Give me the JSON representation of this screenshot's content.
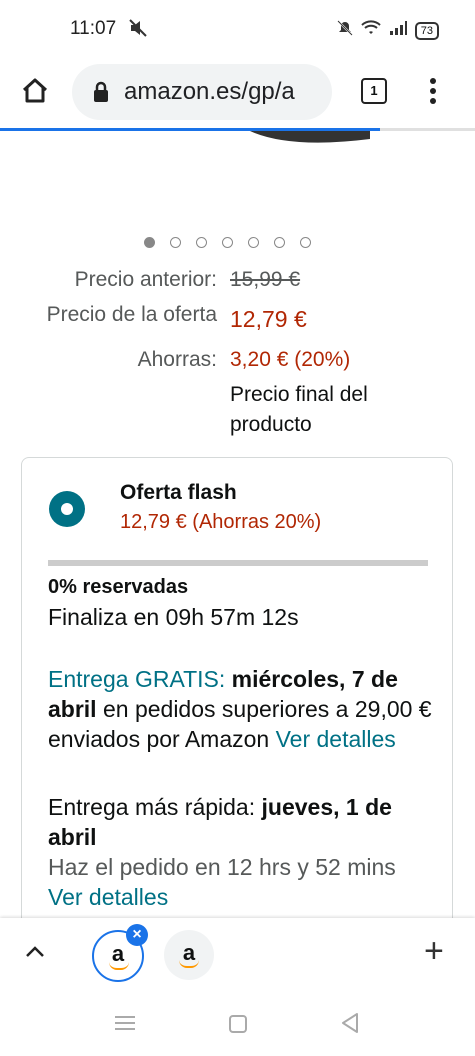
{
  "status_bar": {
    "time": "11:07",
    "battery": "73"
  },
  "browser": {
    "url": "amazon.es/gp/a",
    "tab_count": "1"
  },
  "carousel": {
    "total_dots": 7,
    "active_index": 0
  },
  "prices": {
    "previous_label": "Precio anterior:",
    "previous_value": "15,99 €",
    "offer_label": "Precio de la oferta",
    "offer_value": "12,79 €",
    "savings_label": "Ahorras:",
    "savings_value": "3,20 € (20%)",
    "final_note_1": "Precio final del",
    "final_note_2": "producto"
  },
  "flash_offer": {
    "title": "Oferta flash",
    "price": "12,79 € (Ahorras 20%)",
    "reserved": "0% reservadas",
    "ends": "Finaliza en 09h 57m 12s",
    "reserved_fraction": 0
  },
  "delivery": {
    "free_label": "Entrega GRATIS:",
    "date_bold": "miércoles, 7 de abril",
    "rest": "en pedidos superiores a 29,00 € enviados por Amazon",
    "details_link": "Ver detalles"
  },
  "fast_delivery": {
    "label": "Entrega más rápida:",
    "date_bold": "jueves, 1 de abril",
    "order_text": "Haz el pedido en 12 hrs y 52 mins",
    "details_link": "Ver detalles"
  },
  "tab_strip": {
    "tab1_letter": "a",
    "tab2_letter": "a"
  },
  "colors": {
    "accent": "#007185",
    "price_red": "#b12704",
    "chrome_blue": "#1a73e8"
  }
}
